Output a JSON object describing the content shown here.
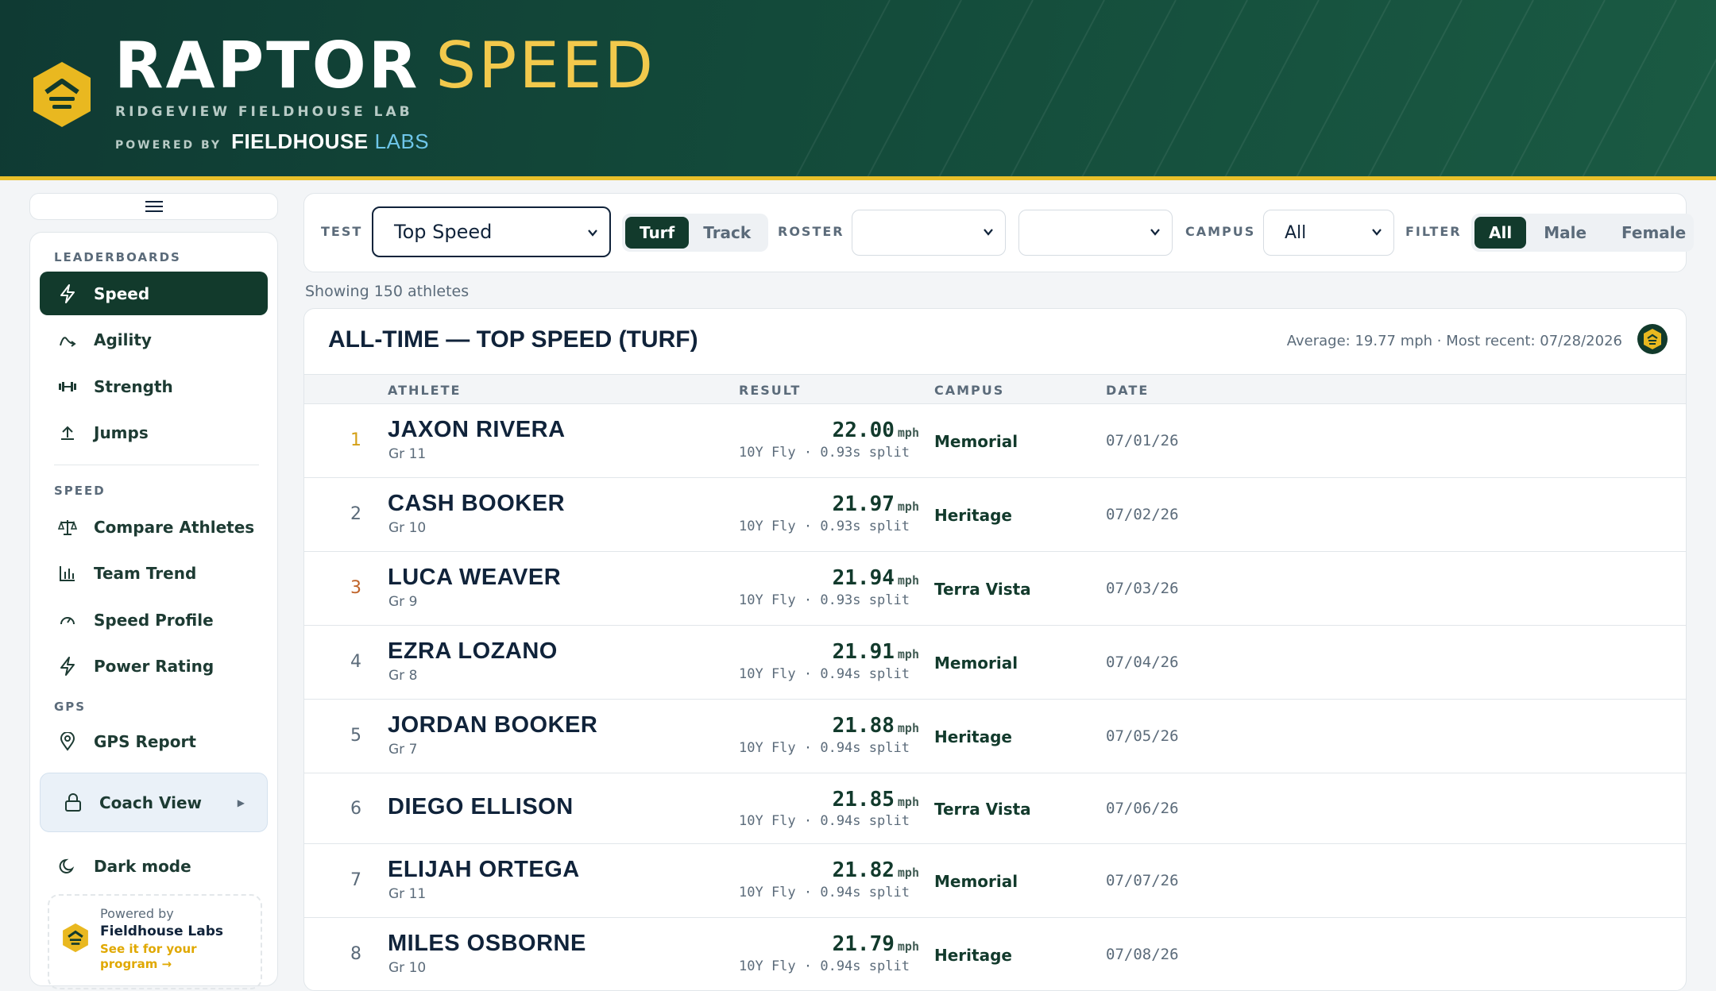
{
  "header": {
    "brand_word1": "RAPTOR",
    "brand_word2": "SPEED",
    "subtitle": "RIDGEVIEW FIELDHOUSE LAB",
    "powered_by": "POWERED BY",
    "powered_name": "FIELDHOUSE",
    "powered_suffix": "LABS"
  },
  "sidebar": {
    "menu_icon": "hamburger-icon",
    "leaderboards_label": "LEADERBOARDS",
    "leaderboards": [
      {
        "label": "Speed",
        "icon": "bolt-icon",
        "active": true
      },
      {
        "label": "Agility",
        "icon": "agility-icon"
      },
      {
        "label": "Strength",
        "icon": "dumbbell-icon"
      },
      {
        "label": "Jumps",
        "icon": "jump-icon"
      }
    ],
    "speed_label": "SPEED",
    "speed_items": [
      {
        "label": "Compare Athletes",
        "icon": "scale-icon"
      },
      {
        "label": "Team Trend",
        "icon": "bar-chart-icon"
      },
      {
        "label": "Speed Profile",
        "icon": "gauge-icon"
      },
      {
        "label": "Power Rating",
        "icon": "bolt-icon"
      }
    ],
    "gps_label": "GPS",
    "gps_items": [
      {
        "label": "GPS Report",
        "icon": "map-pin-icon"
      }
    ],
    "coach_view": "Coach View",
    "dark_mode": "Dark mode",
    "promo": {
      "line1": "Powered by",
      "line2": "Fieldhouse Labs",
      "line3": "See it for your program →"
    }
  },
  "filters": {
    "test_label": "TEST",
    "test_value": "Top Speed",
    "surface_options": [
      "Turf",
      "Track"
    ],
    "surface_selected": "Turf",
    "roster_label": "ROSTER",
    "roster_value_1": "",
    "roster_value_2": "",
    "campus_label": "CAMPUS",
    "campus_value": "All",
    "filter_label": "FILTER",
    "gender_options": [
      "All",
      "Male",
      "Female"
    ],
    "gender_selected": "All"
  },
  "showing": "Showing 150 athletes",
  "leaderboard": {
    "title": "ALL-TIME — TOP SPEED (TURF)",
    "meta": "Average: 19.77 mph · Most recent: 07/28/2026",
    "columns": [
      "ATHLETE",
      "RESULT",
      "CAMPUS",
      "DATE"
    ],
    "unit": "mph",
    "rows": [
      {
        "rank": "1",
        "name": "JAXON RIVERA",
        "grade": "Gr 11",
        "result": "22.00",
        "split": "10Y Fly · 0.93s split",
        "campus": "Memorial",
        "date": "07/01/26"
      },
      {
        "rank": "2",
        "name": "CASH BOOKER",
        "grade": "Gr 10",
        "result": "21.97",
        "split": "10Y Fly · 0.93s split",
        "campus": "Heritage",
        "date": "07/02/26"
      },
      {
        "rank": "3",
        "name": "LUCA WEAVER",
        "grade": "Gr 9",
        "result": "21.94",
        "split": "10Y Fly · 0.93s split",
        "campus": "Terra Vista",
        "date": "07/03/26"
      },
      {
        "rank": "4",
        "name": "EZRA LOZANO",
        "grade": "Gr 8",
        "result": "21.91",
        "split": "10Y Fly · 0.94s split",
        "campus": "Memorial",
        "date": "07/04/26"
      },
      {
        "rank": "5",
        "name": "JORDAN BOOKER",
        "grade": "Gr 7",
        "result": "21.88",
        "split": "10Y Fly · 0.94s split",
        "campus": "Heritage",
        "date": "07/05/26"
      },
      {
        "rank": "6",
        "name": "DIEGO ELLISON",
        "grade": "",
        "result": "21.85",
        "split": "10Y Fly · 0.94s split",
        "campus": "Terra Vista",
        "date": "07/06/26"
      },
      {
        "rank": "7",
        "name": "ELIJAH ORTEGA",
        "grade": "Gr 11",
        "result": "21.82",
        "split": "10Y Fly · 0.94s split",
        "campus": "Memorial",
        "date": "07/07/26"
      },
      {
        "rank": "8",
        "name": "MILES OSBORNE",
        "grade": "Gr 10",
        "result": "21.79",
        "split": "10Y Fly · 0.94s split",
        "campus": "Heritage",
        "date": "07/08/26"
      }
    ]
  }
}
